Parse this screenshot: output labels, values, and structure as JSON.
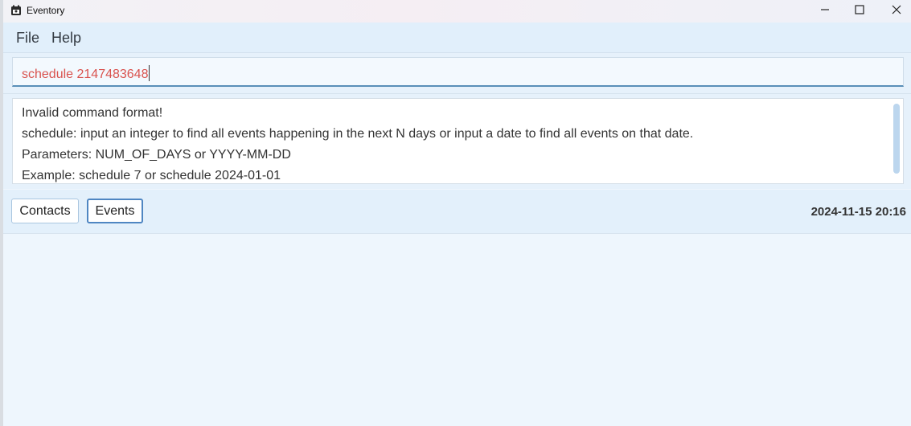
{
  "window": {
    "title": "Eventory",
    "icons": {
      "app": "calendar-icon",
      "minimize": "minimize-icon",
      "maximize": "maximize-icon",
      "close": "close-icon"
    }
  },
  "menu": {
    "file": "File",
    "help": "Help"
  },
  "command": {
    "value": "schedule 2147483648",
    "text_color": "#d9534f"
  },
  "result": {
    "lines": [
      "Invalid command format!",
      "schedule: input an integer to find all events happening in the next N days or input a date to find all events on that date.",
      "Parameters: NUM_OF_DAYS or YYYY-MM-DD",
      "Example: schedule 7 or schedule 2024-01-01"
    ]
  },
  "tabs": {
    "contacts": "Contacts",
    "events": "Events",
    "selected": "Events"
  },
  "status": {
    "datetime": "2024-11-15 20:16"
  },
  "colors": {
    "accent": "#4f86c2",
    "background": "#eff6fd"
  }
}
